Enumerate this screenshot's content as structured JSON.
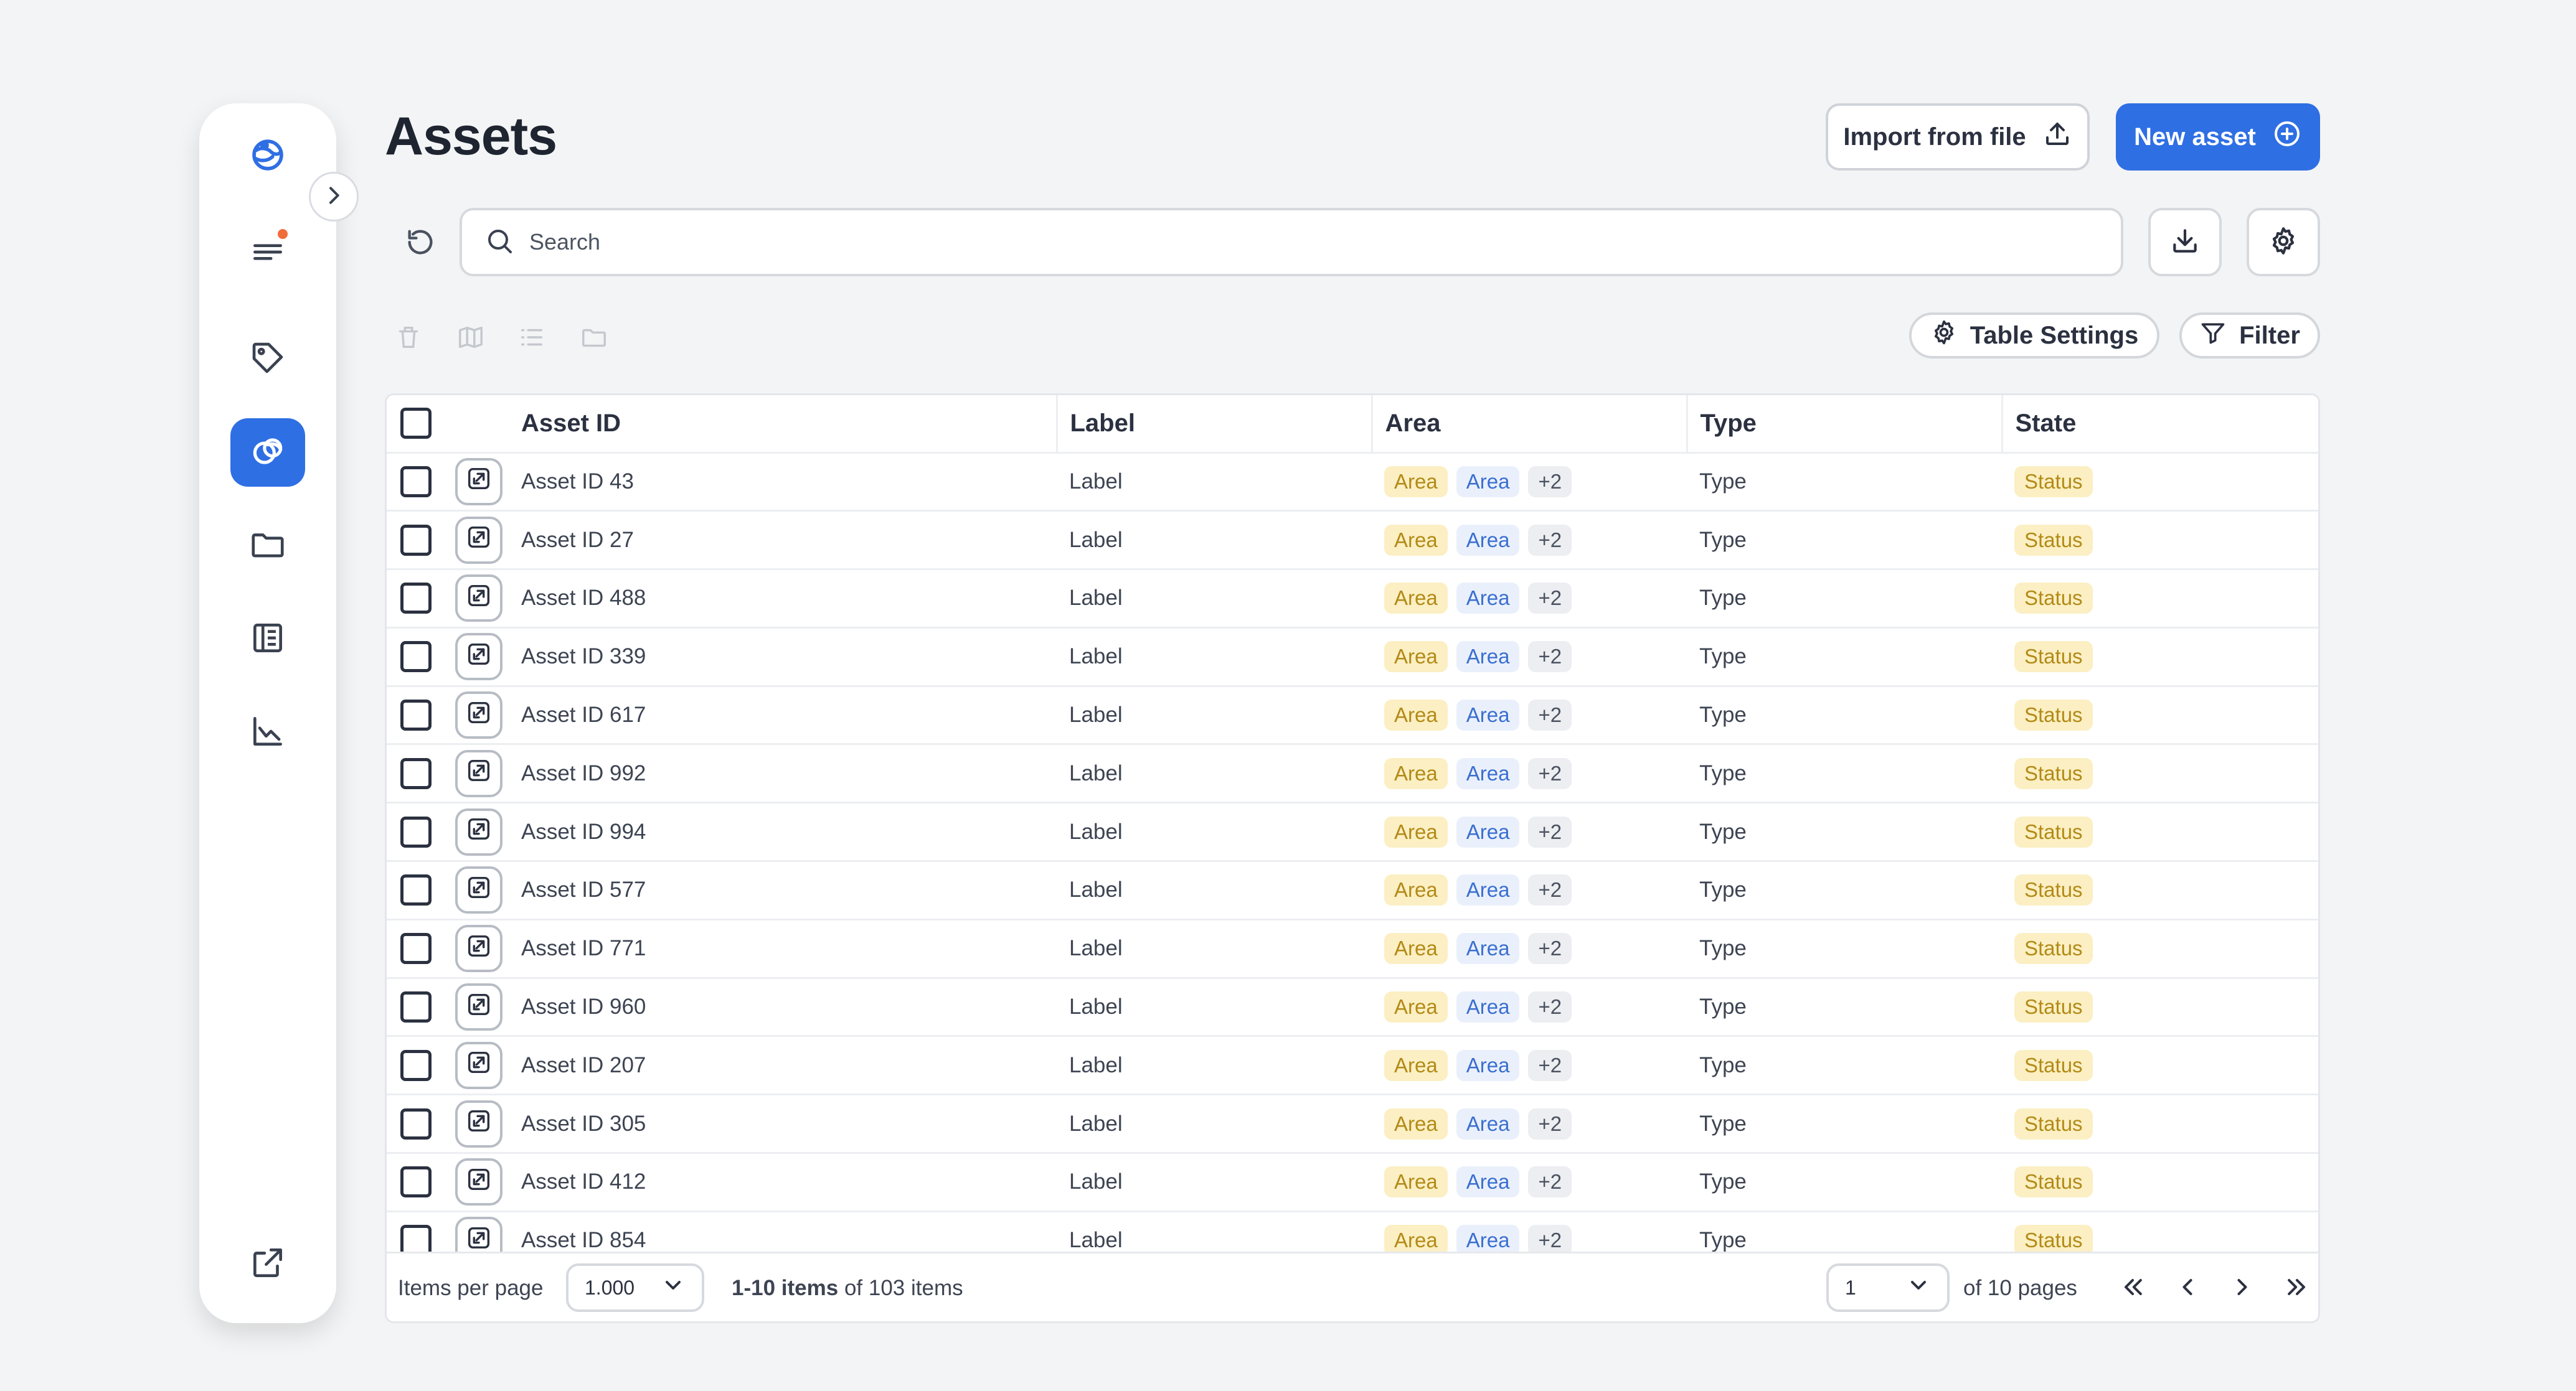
{
  "page": {
    "title": "Assets"
  },
  "header": {
    "import_label": "Import from file",
    "new_label": "New asset"
  },
  "search": {
    "placeholder": "Search"
  },
  "toolbar": {
    "table_settings_label": "Table Settings",
    "filter_label": "Filter"
  },
  "sidebar": {
    "items": [
      {
        "icon": "logo-icon"
      },
      {
        "icon": "menu-lines-icon",
        "notification": true
      },
      {
        "icon": "tag-icon"
      },
      {
        "icon": "assets-icon",
        "active": true
      },
      {
        "icon": "folder-icon"
      },
      {
        "icon": "book-icon"
      },
      {
        "icon": "chart-icon"
      },
      {
        "icon": "external-link-icon"
      }
    ]
  },
  "table": {
    "columns": [
      "Asset ID",
      "Label",
      "Area",
      "Type",
      "State"
    ],
    "rows": [
      {
        "id": "Asset ID 43",
        "label": "Label",
        "area1": "Area",
        "area2": "Area",
        "more": "+2",
        "type": "Type",
        "state": "Status"
      },
      {
        "id": "Asset ID 27",
        "label": "Label",
        "area1": "Area",
        "area2": "Area",
        "more": "+2",
        "type": "Type",
        "state": "Status"
      },
      {
        "id": "Asset ID 488",
        "label": "Label",
        "area1": "Area",
        "area2": "Area",
        "more": "+2",
        "type": "Type",
        "state": "Status"
      },
      {
        "id": "Asset ID 339",
        "label": "Label",
        "area1": "Area",
        "area2": "Area",
        "more": "+2",
        "type": "Type",
        "state": "Status"
      },
      {
        "id": "Asset ID 617",
        "label": "Label",
        "area1": "Area",
        "area2": "Area",
        "more": "+2",
        "type": "Type",
        "state": "Status"
      },
      {
        "id": "Asset ID 992",
        "label": "Label",
        "area1": "Area",
        "area2": "Area",
        "more": "+2",
        "type": "Type",
        "state": "Status"
      },
      {
        "id": "Asset ID 994",
        "label": "Label",
        "area1": "Area",
        "area2": "Area",
        "more": "+2",
        "type": "Type",
        "state": "Status"
      },
      {
        "id": "Asset ID 577",
        "label": "Label",
        "area1": "Area",
        "area2": "Area",
        "more": "+2",
        "type": "Type",
        "state": "Status"
      },
      {
        "id": "Asset ID 771",
        "label": "Label",
        "area1": "Area",
        "area2": "Area",
        "more": "+2",
        "type": "Type",
        "state": "Status"
      },
      {
        "id": "Asset ID 960",
        "label": "Label",
        "area1": "Area",
        "area2": "Area",
        "more": "+2",
        "type": "Type",
        "state": "Status"
      },
      {
        "id": "Asset ID 207",
        "label": "Label",
        "area1": "Area",
        "area2": "Area",
        "more": "+2",
        "type": "Type",
        "state": "Status"
      },
      {
        "id": "Asset ID 305",
        "label": "Label",
        "area1": "Area",
        "area2": "Area",
        "more": "+2",
        "type": "Type",
        "state": "Status"
      },
      {
        "id": "Asset ID 412",
        "label": "Label",
        "area1": "Area",
        "area2": "Area",
        "more": "+2",
        "type": "Type",
        "state": "Status"
      },
      {
        "id": "Asset ID 854",
        "label": "Label",
        "area1": "Area",
        "area2": "Area",
        "more": "+2",
        "type": "Type",
        "state": "Status"
      }
    ]
  },
  "footer": {
    "items_per_page_label": "Items per page",
    "items_per_page_value": "1.000",
    "range_text": "1-10 items",
    "of_items_text": "of 103 items",
    "page_value": "1",
    "of_pages_text": "of 10 pages"
  },
  "colors": {
    "accent": "#2f6fe4",
    "tag_yellow_bg": "#fbefc3",
    "tag_yellow_text": "#b38a16",
    "tag_blue_bg": "#eaf0fb",
    "tag_blue_text": "#3a6fd0",
    "notification_dot": "#f26b3a"
  }
}
